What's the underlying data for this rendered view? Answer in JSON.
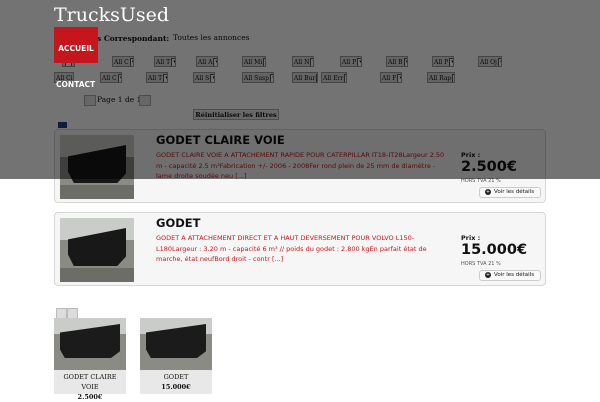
{
  "header": {
    "site_title": "TrucksUsed",
    "menu": {
      "home": "ACCUEIL",
      "contact": "CONTACT"
    }
  },
  "filters": {
    "label": "s Correspondant:",
    "all_link": "Toutes les annonces",
    "row1": [
      "",
      "All C",
      "All T",
      "All A",
      "All Mi",
      "All N",
      "All P",
      "All B",
      "All P",
      "All Oj"
    ],
    "row2": [
      "All Ci",
      "All C",
      "All T",
      "All S",
      "All Susp",
      "All Bur",
      "All Err",
      "All F",
      "All Rap"
    ],
    "reset_label": "Réinitialiser les filtres"
  },
  "pagination": {
    "text": "Page 1 de 1"
  },
  "listings": [
    {
      "title": "GODET CLAIRE VOIE",
      "description": "GODET CLAIRE VOIE A ATTACHEMENT RAPIDE POUR CATERPILLAR IT18-IT28Largeur 2.50 m - capacité 2.5 m³Fabrication +/- 2006 - 2008Fer rond plein de 25 mm de diamètre - lame droite soudée neu [...]",
      "price_label": "Prix :",
      "price": "2.500€",
      "tax": "HORS TVA 21 %",
      "details": "Voir les détails"
    },
    {
      "title": "GODET",
      "description": "GODET A ATTACHEMENT DIRECT ET A HAUT DEVERSEMENT POUR VOLVO L150-L180Largeur : 3.20 m - capacité 6 m³ // poids du godet : 2.800 kgEn parfait état de marche, état neufBord droit - contr [...]",
      "price_label": "Prix :",
      "price": "15.000€",
      "tax": "HORS TVA 21 %",
      "details": "Voir les détails"
    }
  ],
  "thumbnails": [
    {
      "name": "GODET CLAIRE VOIE",
      "price": "2.500€"
    },
    {
      "name": "GODET",
      "price": "15.000€"
    }
  ],
  "colors": {
    "accent": "#c4161c",
    "overlay": "rgba(0,0,0,0.55)"
  },
  "icons": {
    "details": "plus-circle-icon",
    "flag": "flag-icon"
  }
}
